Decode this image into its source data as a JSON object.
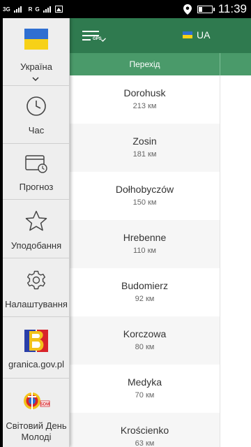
{
  "status_bar": {
    "network1": "3G",
    "network2": "R",
    "time": "11:39"
  },
  "sidebar": {
    "country_label": "Україна",
    "items": [
      {
        "label": "Час",
        "icon": "clock-icon"
      },
      {
        "label": "Прогноз",
        "icon": "calendar-icon"
      },
      {
        "label": "Уподобання",
        "icon": "star-icon"
      },
      {
        "label": "Налаштування",
        "icon": "gear-icon"
      },
      {
        "label": "granica.gov.pl",
        "icon": "granica-logo-icon"
      },
      {
        "label": "Світовий День Молоді",
        "icon": "sdm-logo-icon"
      }
    ]
  },
  "header": {
    "gps_label": "GPS",
    "country_code": "UA"
  },
  "table": {
    "column_header": "Перехід",
    "rows": [
      {
        "name": "Dorohusk",
        "distance": "213 км"
      },
      {
        "name": "Zosin",
        "distance": "181 км"
      },
      {
        "name": "Dołhobyczów",
        "distance": "150 км"
      },
      {
        "name": "Hrebenne",
        "distance": "110 км"
      },
      {
        "name": "Budomierz",
        "distance": "92 км"
      },
      {
        "name": "Korczowa",
        "distance": "80 км"
      },
      {
        "name": "Medyka",
        "distance": "70 км"
      },
      {
        "name": "Krościenko",
        "distance": "63 км"
      }
    ]
  },
  "colors": {
    "header_green": "#2f7a4f",
    "column_header_green": "#4a9a6a",
    "flag_blue": "#2f6fd1",
    "flag_yellow": "#f7d117"
  }
}
